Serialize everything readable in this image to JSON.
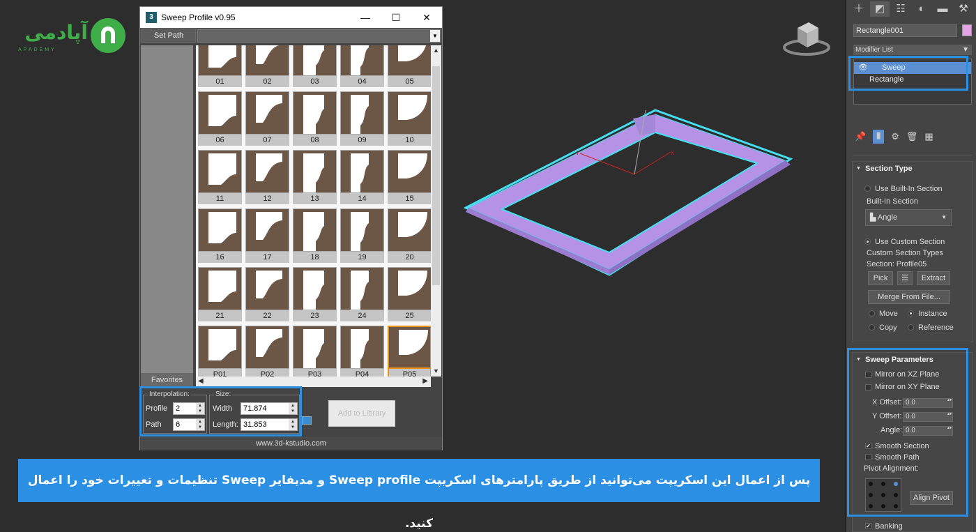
{
  "logo": {
    "text": "آپادمی",
    "subtext": "APADEMY"
  },
  "window": {
    "title": "Sweep Profile v0.95",
    "app_icon": "3",
    "set_path_label": "Set Path",
    "favorites_label": "Favorites",
    "profiles": [
      "01",
      "02",
      "03",
      "04",
      "05",
      "06",
      "07",
      "08",
      "09",
      "10",
      "11",
      "12",
      "13",
      "14",
      "15",
      "16",
      "17",
      "18",
      "19",
      "20",
      "21",
      "22",
      "23",
      "24",
      "25",
      "P01",
      "P02",
      "P03",
      "P04",
      "P05"
    ],
    "selected_profile": "P05",
    "interpolation": {
      "label": "Interpolation:",
      "profile_label": "Profile",
      "profile_value": "2",
      "path_label": "Path",
      "path_value": "6"
    },
    "size": {
      "label": "Size:",
      "width_label": "Width",
      "width_value": "71.874",
      "length_label": "Length:",
      "length_value": "31.853"
    },
    "add_library_label": "Add to Library",
    "url": "www.3d-kstudio.com"
  },
  "banner": {
    "text": "پس از اعمال این اسکریپت می‌توانید از طریق پارامترهای اسکریپت Sweep profile و مدیفایر Sweep تنظیمات و تغییرات خود را اعمال کنید."
  },
  "panel": {
    "object_name": "Rectangle001",
    "object_color": "#e5a3e5",
    "modifier_list_label": "Modifier List",
    "stack": [
      "Sweep",
      "Rectangle"
    ],
    "section_type": {
      "title": "Section Type",
      "use_builtin": "Use Built-In Section",
      "builtin_label": "Built-In Section",
      "builtin_value": "Angle",
      "use_custom": "Use Custom Section",
      "custom_types_label": "Custom Section Types",
      "section_label": "Section: Profile05",
      "pick": "Pick",
      "extract": "Extract",
      "merge": "Merge From File...",
      "move": "Move",
      "instance": "Instance",
      "copy": "Copy",
      "reference": "Reference"
    },
    "sweep_params": {
      "title": "Sweep Parameters",
      "mirror_xz": "Mirror on XZ Plane",
      "mirror_xy": "Mirror on XY Plane",
      "x_offset_label": "X Offset:",
      "x_offset": "0.0",
      "y_offset_label": "Y Offset:",
      "y_offset": "0.0",
      "angle_label": "Angle:",
      "angle": "0.0",
      "smooth_section": "Smooth Section",
      "smooth_path": "Smooth Path",
      "pivot_label": "Pivot Alignment:",
      "align_pivot": "Align Pivot",
      "banking": "Banking"
    }
  },
  "colors": {
    "accent": "#2d8fe0",
    "selection": "#e8921a",
    "object": "#b592e6",
    "highlight_edge": "#45e0f0",
    "brand": "#3fae49"
  }
}
